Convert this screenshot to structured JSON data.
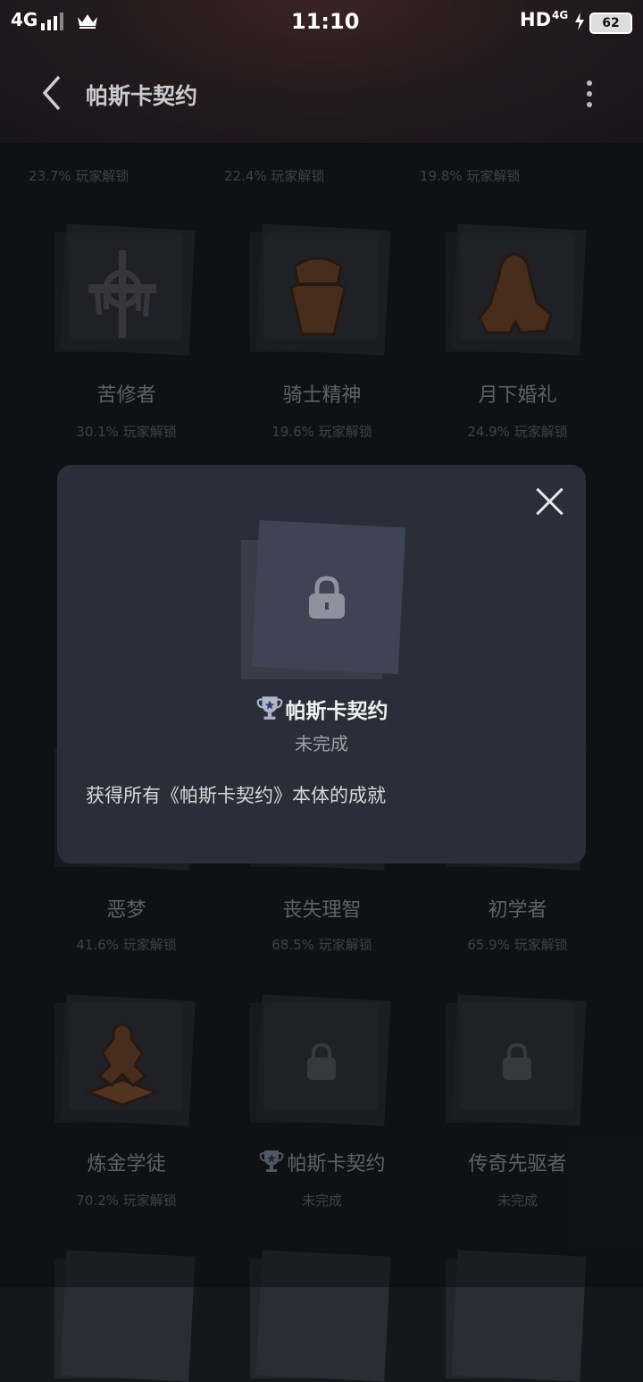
{
  "status_bar": {
    "network": "4G",
    "time": "11:10",
    "hd": "HD",
    "net2": "4G",
    "battery": "62"
  },
  "header": {
    "title": "帕斯卡契约"
  },
  "top_partial_row": [
    "23.7% 玩家解锁",
    "22.4% 玩家解锁",
    "19.8% 玩家解锁"
  ],
  "achievements": [
    {
      "name": "苦修者",
      "stat": "30.1% 玩家解锁",
      "icon": "cross-sword-icon"
    },
    {
      "name": "骑士精神",
      "stat": "19.6% 玩家解锁",
      "icon": "knight-helmet-icon"
    },
    {
      "name": "月下婚礼",
      "stat": "24.9% 玩家解锁",
      "icon": "cloak-figure-icon"
    },
    {
      "name": "恶梦",
      "stat": "41.6% 玩家解锁"
    },
    {
      "name": "丧失理智",
      "stat": "68.5% 玩家解锁"
    },
    {
      "name": "初学者",
      "stat": "65.9% 玩家解锁"
    },
    {
      "name": "炼金学徒",
      "stat": "70.2% 玩家解锁",
      "icon": "alchemy-icon"
    },
    {
      "name": "帕斯卡契约",
      "stat": "未完成",
      "icon": "lock-icon",
      "trophy": true
    },
    {
      "name": "传奇先驱者",
      "stat": "未完成",
      "icon": "lock-icon"
    }
  ],
  "modal": {
    "name": "帕斯卡契约",
    "status": "未完成",
    "description": "获得所有《帕斯卡契约》本体的成就"
  }
}
